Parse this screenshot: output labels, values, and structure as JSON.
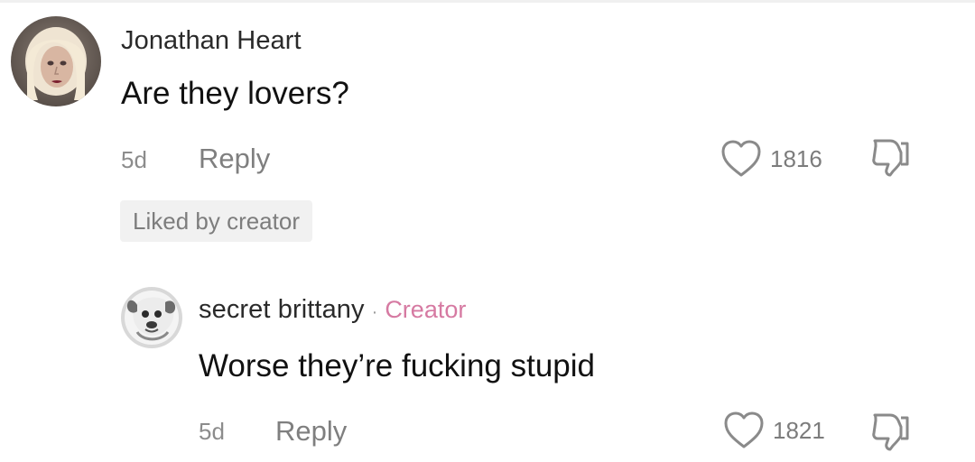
{
  "comment": {
    "username": "Jonathan Heart",
    "text": "Are they lovers?",
    "time": "5d",
    "reply_label": "Reply",
    "like_count": "1816",
    "liked_badge": "Liked by creator",
    "avatar_icon": "blonde-person-avatar-icon"
  },
  "reply": {
    "username": "secret brittany",
    "separator": "·",
    "creator_label": "Creator",
    "text": "Worse they’re fucking stupid",
    "time": "5d",
    "reply_label": "Reply",
    "like_count": "1821",
    "avatar_icon": "dog-avatar-icon"
  },
  "icons": {
    "like": "heart-outline-icon",
    "dislike": "thumbs-down-outline-icon"
  },
  "colors": {
    "background": "#ffffff",
    "username": "#2a2a2a",
    "text": "#111111",
    "muted": "#8c8c8c",
    "badge_background": "#f1f1f1",
    "creator_pink": "#d67aa2"
  }
}
